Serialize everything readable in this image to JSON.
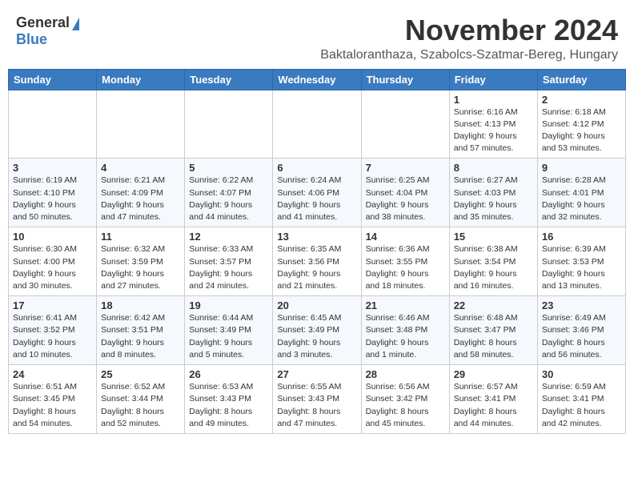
{
  "header": {
    "logo_general": "General",
    "logo_blue": "Blue",
    "month_title": "November 2024",
    "location": "Baktaloranthaza, Szabolcs-Szatmar-Bereg, Hungary"
  },
  "weekdays": [
    "Sunday",
    "Monday",
    "Tuesday",
    "Wednesday",
    "Thursday",
    "Friday",
    "Saturday"
  ],
  "weeks": [
    [
      {
        "day": "",
        "info": ""
      },
      {
        "day": "",
        "info": ""
      },
      {
        "day": "",
        "info": ""
      },
      {
        "day": "",
        "info": ""
      },
      {
        "day": "",
        "info": ""
      },
      {
        "day": "1",
        "info": "Sunrise: 6:16 AM\nSunset: 4:13 PM\nDaylight: 9 hours\nand 57 minutes."
      },
      {
        "day": "2",
        "info": "Sunrise: 6:18 AM\nSunset: 4:12 PM\nDaylight: 9 hours\nand 53 minutes."
      }
    ],
    [
      {
        "day": "3",
        "info": "Sunrise: 6:19 AM\nSunset: 4:10 PM\nDaylight: 9 hours\nand 50 minutes."
      },
      {
        "day": "4",
        "info": "Sunrise: 6:21 AM\nSunset: 4:09 PM\nDaylight: 9 hours\nand 47 minutes."
      },
      {
        "day": "5",
        "info": "Sunrise: 6:22 AM\nSunset: 4:07 PM\nDaylight: 9 hours\nand 44 minutes."
      },
      {
        "day": "6",
        "info": "Sunrise: 6:24 AM\nSunset: 4:06 PM\nDaylight: 9 hours\nand 41 minutes."
      },
      {
        "day": "7",
        "info": "Sunrise: 6:25 AM\nSunset: 4:04 PM\nDaylight: 9 hours\nand 38 minutes."
      },
      {
        "day": "8",
        "info": "Sunrise: 6:27 AM\nSunset: 4:03 PM\nDaylight: 9 hours\nand 35 minutes."
      },
      {
        "day": "9",
        "info": "Sunrise: 6:28 AM\nSunset: 4:01 PM\nDaylight: 9 hours\nand 32 minutes."
      }
    ],
    [
      {
        "day": "10",
        "info": "Sunrise: 6:30 AM\nSunset: 4:00 PM\nDaylight: 9 hours\nand 30 minutes."
      },
      {
        "day": "11",
        "info": "Sunrise: 6:32 AM\nSunset: 3:59 PM\nDaylight: 9 hours\nand 27 minutes."
      },
      {
        "day": "12",
        "info": "Sunrise: 6:33 AM\nSunset: 3:57 PM\nDaylight: 9 hours\nand 24 minutes."
      },
      {
        "day": "13",
        "info": "Sunrise: 6:35 AM\nSunset: 3:56 PM\nDaylight: 9 hours\nand 21 minutes."
      },
      {
        "day": "14",
        "info": "Sunrise: 6:36 AM\nSunset: 3:55 PM\nDaylight: 9 hours\nand 18 minutes."
      },
      {
        "day": "15",
        "info": "Sunrise: 6:38 AM\nSunset: 3:54 PM\nDaylight: 9 hours\nand 16 minutes."
      },
      {
        "day": "16",
        "info": "Sunrise: 6:39 AM\nSunset: 3:53 PM\nDaylight: 9 hours\nand 13 minutes."
      }
    ],
    [
      {
        "day": "17",
        "info": "Sunrise: 6:41 AM\nSunset: 3:52 PM\nDaylight: 9 hours\nand 10 minutes."
      },
      {
        "day": "18",
        "info": "Sunrise: 6:42 AM\nSunset: 3:51 PM\nDaylight: 9 hours\nand 8 minutes."
      },
      {
        "day": "19",
        "info": "Sunrise: 6:44 AM\nSunset: 3:49 PM\nDaylight: 9 hours\nand 5 minutes."
      },
      {
        "day": "20",
        "info": "Sunrise: 6:45 AM\nSunset: 3:49 PM\nDaylight: 9 hours\nand 3 minutes."
      },
      {
        "day": "21",
        "info": "Sunrise: 6:46 AM\nSunset: 3:48 PM\nDaylight: 9 hours\nand 1 minute."
      },
      {
        "day": "22",
        "info": "Sunrise: 6:48 AM\nSunset: 3:47 PM\nDaylight: 8 hours\nand 58 minutes."
      },
      {
        "day": "23",
        "info": "Sunrise: 6:49 AM\nSunset: 3:46 PM\nDaylight: 8 hours\nand 56 minutes."
      }
    ],
    [
      {
        "day": "24",
        "info": "Sunrise: 6:51 AM\nSunset: 3:45 PM\nDaylight: 8 hours\nand 54 minutes."
      },
      {
        "day": "25",
        "info": "Sunrise: 6:52 AM\nSunset: 3:44 PM\nDaylight: 8 hours\nand 52 minutes."
      },
      {
        "day": "26",
        "info": "Sunrise: 6:53 AM\nSunset: 3:43 PM\nDaylight: 8 hours\nand 49 minutes."
      },
      {
        "day": "27",
        "info": "Sunrise: 6:55 AM\nSunset: 3:43 PM\nDaylight: 8 hours\nand 47 minutes."
      },
      {
        "day": "28",
        "info": "Sunrise: 6:56 AM\nSunset: 3:42 PM\nDaylight: 8 hours\nand 45 minutes."
      },
      {
        "day": "29",
        "info": "Sunrise: 6:57 AM\nSunset: 3:41 PM\nDaylight: 8 hours\nand 44 minutes."
      },
      {
        "day": "30",
        "info": "Sunrise: 6:59 AM\nSunset: 3:41 PM\nDaylight: 8 hours\nand 42 minutes."
      }
    ]
  ]
}
